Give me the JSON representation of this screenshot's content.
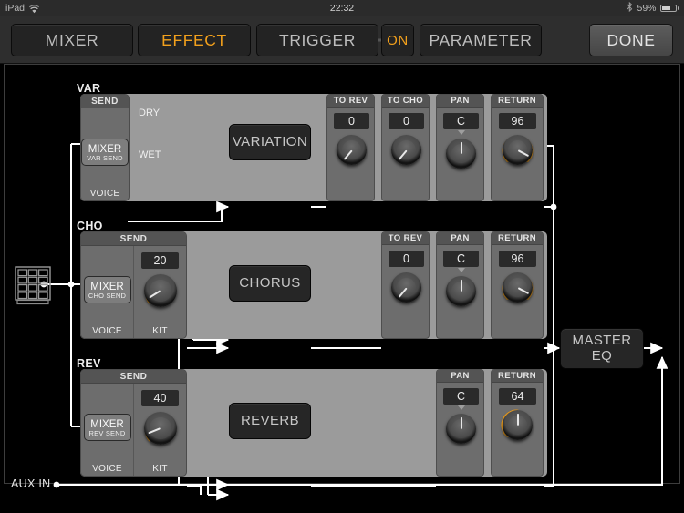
{
  "status_bar": {
    "device": "iPad",
    "wifi_icon": "wifi-icon",
    "time": "22:32",
    "bluetooth_icon": "bluetooth-icon",
    "battery_percent": "59%",
    "battery_icon": "battery-icon"
  },
  "toolbar": {
    "mixer": "MIXER",
    "effect": "EFFECT",
    "trigger": "TRIGGER",
    "trigger_state": "ON",
    "parameter": "PARAMETER",
    "done": "DONE"
  },
  "colors": {
    "accent": "#f2a01c",
    "panel": "#9b9b9b",
    "module": "#6d6d6d",
    "block": "#262626",
    "wire": "#ffffff",
    "background": "#000000"
  },
  "input": {
    "pad_icon": "drum-pad-grid-icon"
  },
  "aux": {
    "label": "AUX IN"
  },
  "master": {
    "label_line1": "MASTER",
    "label_line2": "EQ"
  },
  "sections": [
    {
      "id": "var",
      "group_label": "VAR",
      "send": {
        "header": "SEND",
        "mixer_button_line1": "MIXER",
        "mixer_button_line2": "VAR SEND",
        "columns": [
          {
            "foot": "VOICE",
            "value": null,
            "knob": null
          }
        ]
      },
      "routes": [
        {
          "label": "DRY"
        },
        {
          "label": "WET"
        }
      ],
      "processor": "VARIATION",
      "params": [
        {
          "label": "TO REV",
          "value": "0",
          "knob_angle": -140,
          "arc": false
        },
        {
          "label": "TO CHO",
          "value": "0",
          "knob_angle": -140,
          "arc": false
        },
        {
          "label": "PAN",
          "value": "C",
          "knob_angle": 0,
          "arc": false,
          "marker": true
        },
        {
          "label": "RETURN",
          "value": "96",
          "knob_angle": 62,
          "arc": true
        }
      ]
    },
    {
      "id": "cho",
      "group_label": "CHO",
      "send": {
        "header": "SEND",
        "mixer_button_line1": "MIXER",
        "mixer_button_line2": "CHO SEND",
        "columns": [
          {
            "foot": "VOICE",
            "value": null,
            "knob": null
          },
          {
            "foot": "KIT",
            "value": "20",
            "knob_angle": -122
          }
        ]
      },
      "routes": [],
      "processor": "CHORUS",
      "params": [
        {
          "label": "TO REV",
          "value": "0",
          "knob_angle": -140,
          "arc": false
        },
        {
          "label": "PAN",
          "value": "C",
          "knob_angle": 0,
          "arc": false,
          "marker": true
        },
        {
          "label": "RETURN",
          "value": "96",
          "knob_angle": 62,
          "arc": true
        }
      ]
    },
    {
      "id": "rev",
      "group_label": "REV",
      "send": {
        "header": "SEND",
        "mixer_button_line1": "MIXER",
        "mixer_button_line2": "REV SEND",
        "columns": [
          {
            "foot": "VOICE",
            "value": null,
            "knob": null
          },
          {
            "foot": "KIT",
            "value": "40",
            "knob_angle": -112
          }
        ]
      },
      "routes": [],
      "processor": "REVERB",
      "params": [
        {
          "label": "PAN",
          "value": "C",
          "knob_angle": 0,
          "arc": false,
          "marker": true
        },
        {
          "label": "RETURN",
          "value": "64",
          "knob_angle": 0,
          "arc": true
        }
      ]
    }
  ]
}
